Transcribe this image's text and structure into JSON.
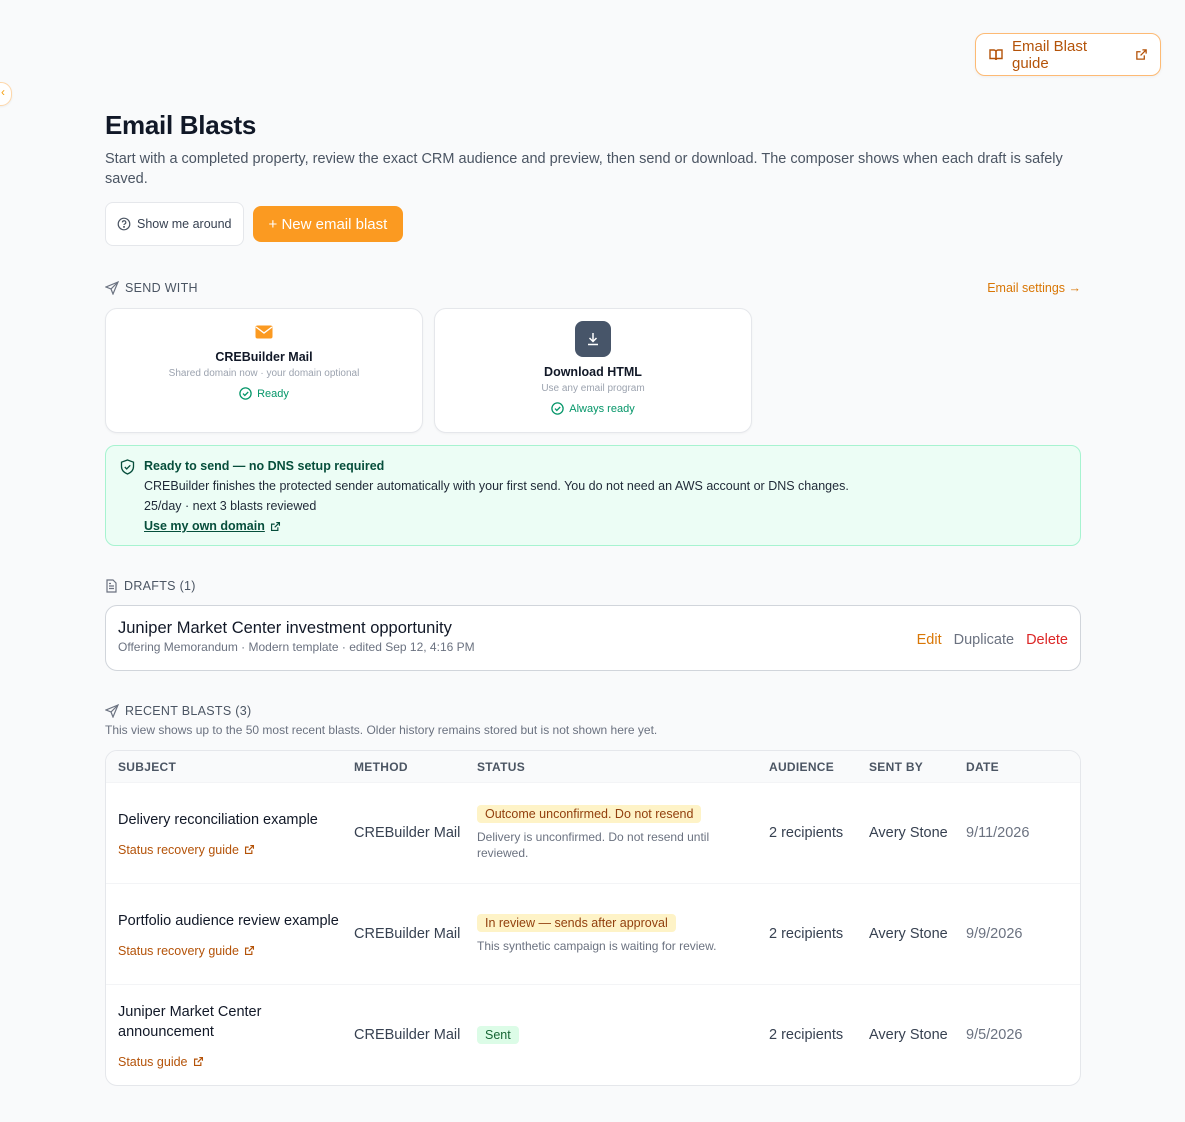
{
  "header": {
    "guide_label": "Email Blast guide",
    "collapse_glyph": "‹"
  },
  "page": {
    "title": "Email Blasts",
    "subtitle": "Start with a completed property, review the exact CRM audience and preview, then send or download. The composer shows when each draft is safely saved.",
    "tour_label": "Show me around",
    "new_label": "+ New email blast"
  },
  "send_with": {
    "label": "SEND WITH",
    "settings_link": "Email settings →",
    "cards": [
      {
        "title": "CREBuilder Mail",
        "sub": "Shared domain now · your domain optional",
        "status": "Ready",
        "icon": "envelope-icon"
      },
      {
        "title": "Download HTML",
        "sub": "Use any email program",
        "status": "Always ready",
        "icon": "download-icon"
      }
    ]
  },
  "notice": {
    "title": "Ready to send — no DNS setup required",
    "body": "CREBuilder finishes the protected sender automatically with your first send. You do not need an AWS account or DNS changes.",
    "quota": "25/day · next 3 blasts reviewed",
    "link": "Use my own domain"
  },
  "drafts": {
    "label": "DRAFTS (1)",
    "items": [
      {
        "title": "Juniper Market Center investment opportunity",
        "meta": "Offering Memorandum · Modern template · edited Sep 12, 4:16 PM",
        "edit": "Edit",
        "duplicate": "Duplicate",
        "delete": "Delete"
      }
    ]
  },
  "recent": {
    "label": "RECENT BLASTS (3)",
    "note": "This view shows up to the 50 most recent blasts. Older history remains stored but is not shown here yet.",
    "columns": [
      "SUBJECT",
      "METHOD",
      "STATUS",
      "AUDIENCE",
      "SENT BY",
      "DATE"
    ],
    "rows": [
      {
        "subject": "Delivery reconciliation example",
        "link": "Status recovery guide",
        "method": "CREBuilder Mail",
        "badge": "Outcome unconfirmed. Do not resend",
        "note": "Delivery is unconfirmed. Do not resend until reviewed.",
        "audience": "2 recipients",
        "sent_by": "Avery Stone",
        "date": "9/11/2026"
      },
      {
        "subject": "Portfolio audience review example",
        "link": "Status recovery guide",
        "method": "CREBuilder Mail",
        "badge": "In review — sends after approval",
        "note": "This synthetic campaign is waiting for review.",
        "audience": "2 recipients",
        "sent_by": "Avery Stone",
        "date": "9/9/2026"
      },
      {
        "subject": "Juniper Market Center announcement",
        "link": "Status guide",
        "method": "CREBuilder Mail",
        "badge": "Sent",
        "note": "",
        "audience": "2 recipients",
        "sent_by": "Avery Stone",
        "date": "9/5/2026"
      }
    ]
  },
  "colors": {
    "accent": "#fb9a21",
    "success": "#059669",
    "danger": "#dc2626"
  }
}
